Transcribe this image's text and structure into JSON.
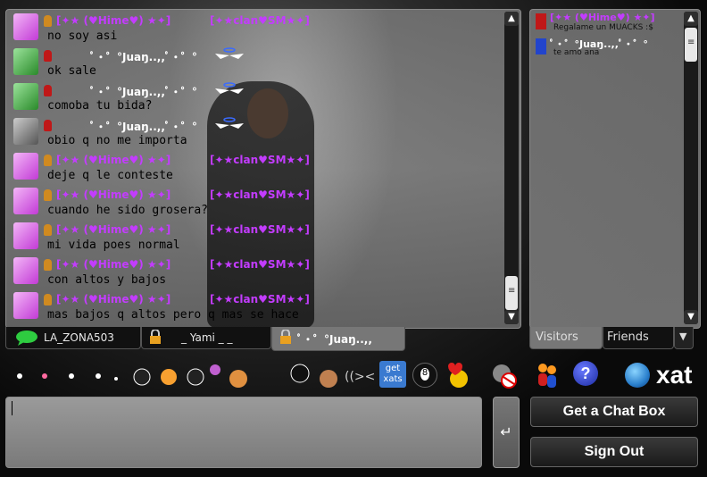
{
  "chat": {
    "messages": [
      {
        "user": "[✦★ (♥Hime♥) ★✦]",
        "tag": "[✦★clan♥SM★✦]",
        "text": "no soy asi",
        "avatar": "pink",
        "rank": "owner"
      },
      {
        "user": "ﾟ・゜°Juaŋ..,,ﾟ・゜°",
        "tag": "",
        "text": "ok sale",
        "avatar": "green",
        "rank": "red"
      },
      {
        "user": "ﾟ・゜°Juaŋ..,,ﾟ・゜°",
        "tag": "",
        "text": "comoba tu bida?",
        "avatar": "green",
        "rank": "red"
      },
      {
        "user": "ﾟ・゜°Juaŋ..,,ﾟ・゜°",
        "tag": "",
        "text": "obio q no me importa",
        "avatar": "gray",
        "rank": "red"
      },
      {
        "user": "[✦★ (♥Hime♥) ★✦]",
        "tag": "[✦★clan♥SM★✦]",
        "text": "deje q le conteste",
        "avatar": "pink",
        "rank": "owner"
      },
      {
        "user": "[✦★ (♥Hime♥) ★✦]",
        "tag": "[✦★clan♥SM★✦]",
        "text": "cuando he sido grosera?",
        "avatar": "pink",
        "rank": "owner"
      },
      {
        "user": "[✦★ (♥Hime♥) ★✦]",
        "tag": "[✦★clan♥SM★✦]",
        "text": "mi vida poes normal",
        "avatar": "pink",
        "rank": "owner"
      },
      {
        "user": "[✦★ (♥Hime♥) ★✦]",
        "tag": "[✦★clan♥SM★✦]",
        "text": "con altos y bajos",
        "avatar": "pink",
        "rank": "owner"
      },
      {
        "user": "[✦★ (♥Hime♥) ★✦]",
        "tag": "[✦★clan♥SM★✦]",
        "text": "mas bajos q altos pero q mas se hace",
        "avatar": "pink",
        "rank": "owner"
      }
    ]
  },
  "tabs": {
    "main": "LA_ZONA503",
    "pc1": "_ Yami _ _",
    "pc2": "ﾟ・゜°Juaŋ..,,"
  },
  "users": [
    {
      "name": "[✦★ (♥Hime♥) ★✦]",
      "status": "Regalame un MUACKS :$",
      "color": "purple"
    },
    {
      "name": "ﾟ・゜°Juaŋ..,,ﾟ・゜°",
      "status": "te amo ana",
      "color": "white"
    }
  ],
  "side_tabs": {
    "visitors": "Visitors",
    "friends": "Friends"
  },
  "emotes": {
    "get_xats": "get xats"
  },
  "buttons": {
    "get_chat_box": "Get a Chat Box",
    "sign_out": "Sign Out",
    "send_glyph": "↵"
  },
  "logo": {
    "text": "xat"
  },
  "icons": {
    "scroll_up": "▲",
    "scroll_down": "▼",
    "scroll_grip": "≡",
    "dropdown": "▼",
    "help": "?",
    "pool_ball": "8"
  },
  "colors": {
    "name_purple": "#c33cff",
    "accent_blue": "#2a7fcc"
  }
}
